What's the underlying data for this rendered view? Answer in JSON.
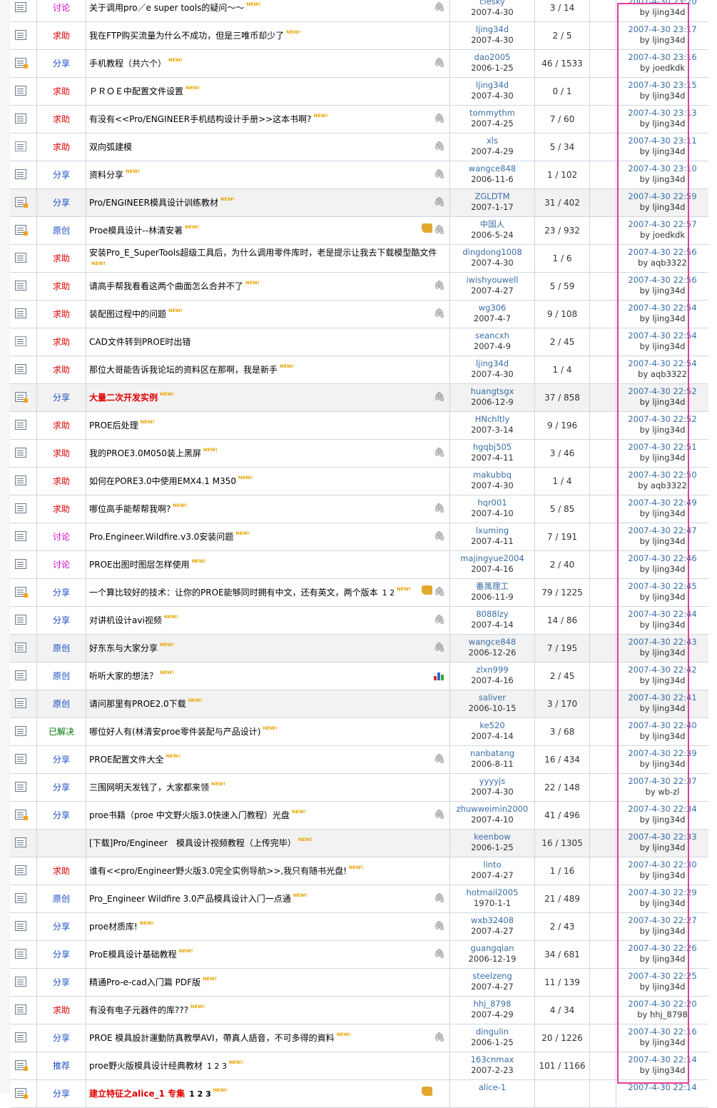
{
  "accent_colors": {
    "discuss": "#cc00cc",
    "help": "#dd0000",
    "share": "#1a4cc4",
    "solved": "#007700",
    "highlight": "#e0409a"
  },
  "rows": [
    {
      "type": "讨论",
      "title": "关于调用pro／e super tools的疑问～～",
      "new": "NEW!",
      "attach": true,
      "author": "clesky",
      "date": "2007-4-30",
      "count": "3 / 14",
      "last_time": "2007-4-30 23:20",
      "last_by": "by ljing34d"
    },
    {
      "type": "求助",
      "title": "我在FTP购买流量为什么不成功，但是三唯币却少了",
      "new": "NEW!",
      "author": "ljing34d",
      "date": "2007-4-30",
      "count": "2 / 5",
      "last_time": "2007-4-30 23:17",
      "last_by": "by ljing34d"
    },
    {
      "type": "分享",
      "title": "手机教程（共六个）",
      "new": "NEW!",
      "attach": true,
      "hot": true,
      "author": "dao2005",
      "date": "2006-1-25",
      "count": "46 / 1533",
      "last_time": "2007-4-30 23:16",
      "last_by": "by joedkdk"
    },
    {
      "type": "求助",
      "title": "ＰＲＯＥ中配置文件设置",
      "new": "NEW!",
      "author": "ljing34d",
      "date": "2007-4-30",
      "count": "0 / 1",
      "last_time": "2007-4-30 23:15",
      "last_by": "by ljing34d"
    },
    {
      "type": "求助",
      "title": "有没有<<Pro/ENGINEER手机结构设计手册>>这本书啊?",
      "new": "NEW!",
      "attach": true,
      "author": "tommythm",
      "date": "2007-4-25",
      "count": "7 / 60",
      "last_time": "2007-4-30 23:13",
      "last_by": "by ljing34d"
    },
    {
      "type": "求助",
      "title": "双向弧建模",
      "attach": true,
      "plain": true,
      "author": "xls",
      "date": "2007-4-29",
      "count": "5 / 34",
      "last_time": "2007-4-30 23:11",
      "last_by": "by ljing34d"
    },
    {
      "type": "分享",
      "title": "资料分享",
      "new": "NEW!",
      "attach": true,
      "author": "wangce848",
      "date": "2006-11-6",
      "count": "1 / 102",
      "last_time": "2007-4-30 23:10",
      "last_by": "by ljing34d"
    },
    {
      "type": "分享",
      "title": "Pro/ENGINEER模具设计训练教材",
      "new": "NEW!",
      "attach": true,
      "alt": true,
      "hot": true,
      "author": "ZGLDTM",
      "date": "2007-1-17",
      "count": "31 / 402",
      "last_time": "2007-4-30 22:59",
      "last_by": "by ljing34d"
    },
    {
      "type": "原创",
      "title": "Proe模具设计--林清安著",
      "new": "NEW!",
      "attach": true,
      "thumb": true,
      "hot": true,
      "author": "中国人",
      "date": "2006-5-24",
      "count": "23 / 932",
      "last_time": "2007-4-30 22:57",
      "last_by": "by joedkdk"
    },
    {
      "type": "求助",
      "title": "安装Pro_E_SuperTools超级工具后，为什么调用零件库时，老是提示让我去下载模型酷文件",
      "new": "NEW!",
      "two": true,
      "author": "dingdong1008",
      "date": "2007-4-30",
      "count": "1 / 6",
      "last_time": "2007-4-30 22:56",
      "last_by": "by aqb3322"
    },
    {
      "type": "求助",
      "title": "请高手帮我看看这两个曲面怎么合并不了",
      "new": "NEW!",
      "attach": true,
      "author": "iwishyouwell",
      "date": "2007-4-27",
      "count": "5 / 59",
      "last_time": "2007-4-30 22:56",
      "last_by": "by ljing34d"
    },
    {
      "type": "求助",
      "title": "装配图过程中的问题",
      "new": "NEW!",
      "attach": true,
      "author": "wg306",
      "date": "2007-4-7",
      "count": "9 / 108",
      "last_time": "2007-4-30 22:54",
      "last_by": "by ljing34d"
    },
    {
      "type": "求助",
      "title": "CAD文件转到PROE时出错",
      "plain": true,
      "author": "seancxh",
      "date": "2007-4-9",
      "count": "2 / 45",
      "last_time": "2007-4-30 22:54",
      "last_by": "by ljing34d"
    },
    {
      "type": "求助",
      "title": "那位大哥能告诉我论坛的资料区在那啊，我是新手",
      "new": "NEW!",
      "author": "ljing34d",
      "date": "2007-4-30",
      "count": "1 / 4",
      "last_time": "2007-4-30 22:54",
      "last_by": "by aqb3322"
    },
    {
      "type": "分享",
      "title": "大量二次开发实例",
      "new": "NEW!",
      "attach": true,
      "alt": true,
      "red": true,
      "hot": true,
      "author": "huangtsgx",
      "date": "2006-12-9",
      "count": "37 / 858",
      "last_time": "2007-4-30 22:52",
      "last_by": "by ljing34d"
    },
    {
      "type": "求助",
      "title": "PROE后处理",
      "new": "NEW!",
      "author": "HNchltly",
      "date": "2007-3-14",
      "count": "9 / 196",
      "last_time": "2007-4-30 22:52",
      "last_by": "by ljing34d"
    },
    {
      "type": "求助",
      "title": "我的PROE3.0M050装上黑屏",
      "new": "NEW!",
      "attach": true,
      "author": "hgqbj505",
      "date": "2007-4-11",
      "count": "3 / 46",
      "last_time": "2007-4-30 22:51",
      "last_by": "by ljing34d"
    },
    {
      "type": "求助",
      "title": "如何在PORE3.0中使用EMX4.1 M350",
      "new": "NEW!",
      "author": "makubbq",
      "date": "2007-4-30",
      "count": "1 / 4",
      "last_time": "2007-4-30 22:50",
      "last_by": "by aqb3322"
    },
    {
      "type": "求助",
      "title": "哪位高手能帮帮我啊?",
      "new": "NEW!",
      "attach": true,
      "author": "hqr001",
      "date": "2007-4-10",
      "count": "5 / 85",
      "last_time": "2007-4-30 22:49",
      "last_by": "by ljing34d"
    },
    {
      "type": "讨论",
      "title": "Pro.Engineer.Wildfire.v3.0安装问题",
      "new": "NEW!",
      "attach": true,
      "author": "lxuming",
      "date": "2007-4-11",
      "count": "7 / 191",
      "last_time": "2007-4-30 22:47",
      "last_by": "by ljing34d"
    },
    {
      "type": "讨论",
      "title": "PROE出图时图层怎样使用",
      "new": "NEW!",
      "author": "majingyue2004",
      "date": "2007-4-16",
      "count": "2 / 40",
      "last_time": "2007-4-30 22:46",
      "last_by": "by ljing34d"
    },
    {
      "type": "分享",
      "title": "一个算比较好的技术：让你的PROE能够同时拥有中文，还有英文，两个版本",
      "pages": "1 2",
      "new": "NEW!",
      "attach": true,
      "thumb": true,
      "hot": true,
      "author": "番禺理工",
      "date": "2006-11-9",
      "count": "79 / 1225",
      "last_time": "2007-4-30 22:45",
      "last_by": "by ljing34d"
    },
    {
      "type": "分享",
      "title": "对讲机设计avi视频",
      "new": "NEW!",
      "attach": true,
      "author": "8088lzy",
      "date": "2007-4-14",
      "count": "14 / 86",
      "last_time": "2007-4-30 22:44",
      "last_by": "by ljing34d"
    },
    {
      "type": "原创",
      "title": "好东东与大家分享",
      "new": "NEW!",
      "attach": true,
      "alt": true,
      "author": "wangce848",
      "date": "2006-12-26",
      "count": "7 / 195",
      "last_time": "2007-4-30 22:43",
      "last_by": "by ljing34d"
    },
    {
      "type": "原创",
      "title": "听听大家的想法？",
      "new": "NEW!",
      "poll": true,
      "author": "zlxn999",
      "date": "2007-4-16",
      "count": "2 / 45",
      "last_time": "2007-4-30 22:42",
      "last_by": "by ljing34d"
    },
    {
      "type": "原创",
      "title": "请问那里有PROE2.0下载",
      "new": "NEW!",
      "alt": true,
      "author": "saliver",
      "date": "2006-10-15",
      "count": "3 / 170",
      "last_time": "2007-4-30 22:41",
      "last_by": "by ljing34d"
    },
    {
      "type": "已解决",
      "title": "哪位好人有(林清安proe零件装配与产品设计)",
      "new": "NEW!",
      "author": "ke520",
      "date": "2007-4-14",
      "count": "3 / 68",
      "last_time": "2007-4-30 22:40",
      "last_by": "by ljing34d"
    },
    {
      "type": "分享",
      "title": "PROE配置文件大全",
      "new": "NEW!",
      "attach": true,
      "author": "nanbatang",
      "date": "2006-8-11",
      "count": "16 / 434",
      "last_time": "2007-4-30 22:39",
      "last_by": "by ljing34d"
    },
    {
      "type": "分享",
      "title": "三围网明天发钱了，大家都来领",
      "new": "NEW!",
      "author": "yyyyjs",
      "date": "2007-4-30",
      "count": "22 / 148",
      "last_time": "2007-4-30 22:37",
      "last_by": "by wb-zl"
    },
    {
      "type": "分享",
      "title": "proe书籍（proe 中文野火版3.0快速入门教程）光盘",
      "new": "NEW!",
      "attach": true,
      "hot": true,
      "author": "zhuwweimin2000",
      "date": "2007-4-10",
      "count": "41 / 496",
      "last_time": "2007-4-30 22:34",
      "last_by": "by ljing34d"
    },
    {
      "type": "",
      "title": "[下载]Pro/Engineer　模具设计视频教程（上传完毕）",
      "new": "NEW!",
      "alt": true,
      "author": "keenbow",
      "date": "2006-1-25",
      "count": "16 / 1305",
      "last_time": "2007-4-30 22:33",
      "last_by": "by ljing34d"
    },
    {
      "type": "求助",
      "title": "谁有<<pro/Engineer野火版3.0完全实例导航>>,我只有随书光盘!",
      "new": "NEW!",
      "author": "linto",
      "date": "2007-4-27",
      "count": "1 / 16",
      "last_time": "2007-4-30 22:30",
      "last_by": "by ljing34d"
    },
    {
      "type": "原创",
      "title": "Pro_Engineer Wildfire 3.0产品模具设计入门一点通",
      "new": "NEW!",
      "attach": true,
      "author": "hotmail2005",
      "date": "1970-1-1",
      "count": "21 / 489",
      "last_time": "2007-4-30 22:29",
      "last_by": "by ljing34d"
    },
    {
      "type": "分享",
      "title": "proe材质库!",
      "new": "NEW!",
      "attach": true,
      "author": "wxb32408",
      "date": "2007-4-27",
      "count": "2 / 43",
      "last_time": "2007-4-30 22:27",
      "last_by": "by ljing34d"
    },
    {
      "type": "分享",
      "title": "ProE模具设计基础教程",
      "new": "NEW!",
      "attach": true,
      "author": "guangqian",
      "date": "2006-12-19",
      "count": "34 / 681",
      "last_time": "2007-4-30 22:26",
      "last_by": "by ljing34d"
    },
    {
      "type": "分享",
      "title": "精通Pro-e-cad入门篇 PDF版",
      "new": "NEW!",
      "author": "steelzeng",
      "date": "2007-4-27",
      "count": "11 / 139",
      "last_time": "2007-4-30 22:25",
      "last_by": "by ljing34d"
    },
    {
      "type": "求助",
      "title": "有没有电子元器件的库???",
      "new": "NEW!",
      "author": "hhj_8798",
      "date": "2007-4-29",
      "count": "4 / 34",
      "last_time": "2007-4-30 22:20",
      "last_by": "by hhj_8798"
    },
    {
      "type": "分享",
      "title": "PROE 模具設計運動防真教學AVI，帶真人語音，不可多得的資料",
      "new": "NEW!",
      "attach": true,
      "author": "dingulin",
      "date": "2006-1-25",
      "count": "20 / 1226",
      "last_time": "2007-4-30 22:16",
      "last_by": "by ljing34d"
    },
    {
      "type": "推荐",
      "title": "proe野火版模具设计经典教材",
      "pages": "1 2 3",
      "new": "NEW!",
      "hot": true,
      "author": "163cnmax",
      "date": "2007-2-23",
      "count": "101 / 1166",
      "last_time": "2007-4-30 22:14",
      "last_by": "by ljing34d"
    },
    {
      "type": "分享",
      "title": "建立特征之alice_1 专集",
      "pages": "1 2 3",
      "new": "NEW!",
      "red": true,
      "thumb": true,
      "hot": true,
      "author": "alice-1",
      "date": "",
      "count": "",
      "last_time": "2007-4-30 22:14",
      "last_by": ""
    }
  ]
}
